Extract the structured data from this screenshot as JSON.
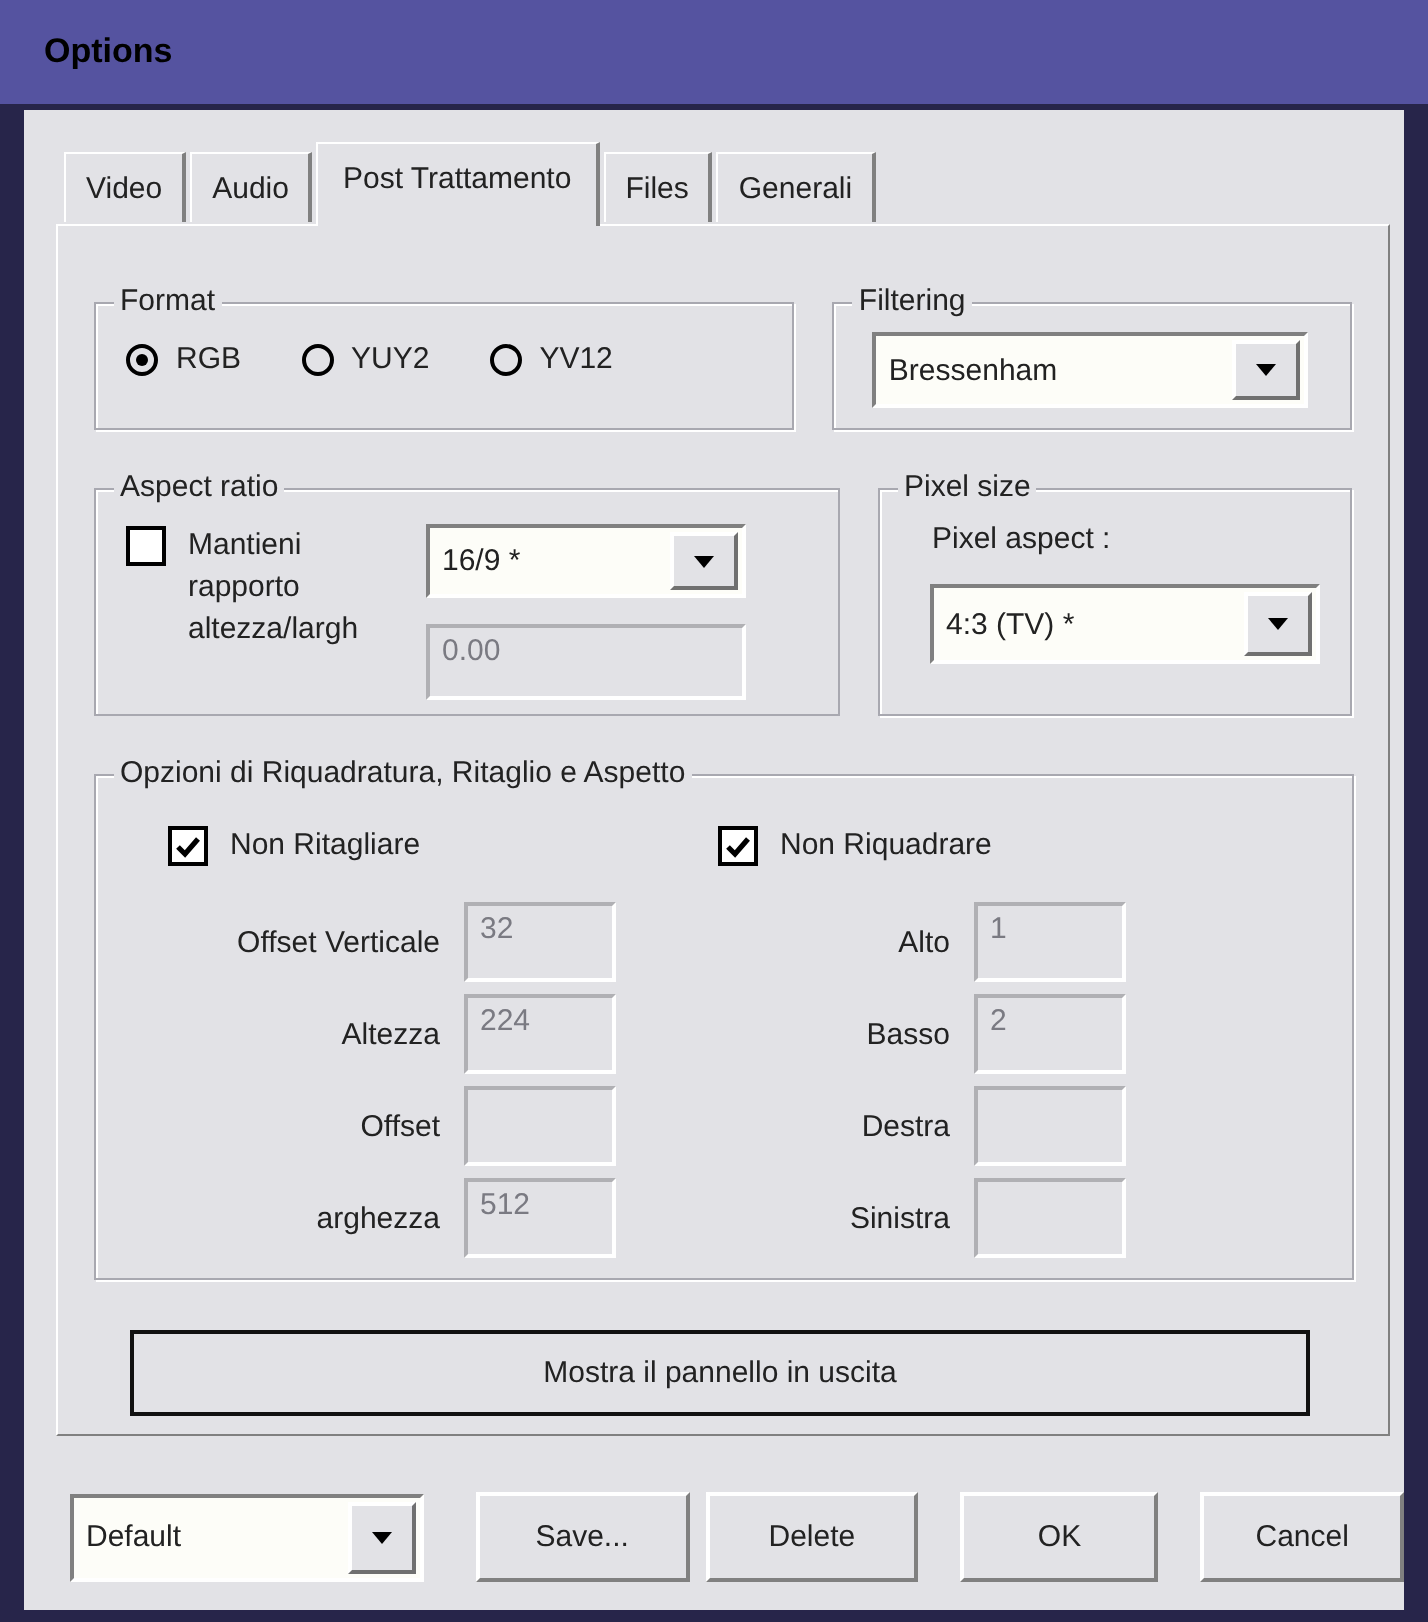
{
  "window": {
    "title": "Options"
  },
  "tabs": [
    {
      "label": "Video",
      "selected": false
    },
    {
      "label": "Audio",
      "selected": false
    },
    {
      "label": "Post Trattamento",
      "selected": true
    },
    {
      "label": "Files",
      "selected": false
    },
    {
      "label": "Generali",
      "selected": false
    }
  ],
  "format": {
    "label": "Format",
    "options": [
      {
        "label": "RGB",
        "selected": true
      },
      {
        "label": "YUY2",
        "selected": false
      },
      {
        "label": "YV12",
        "selected": false
      }
    ]
  },
  "filtering": {
    "label": "Filtering",
    "value": "Bressenham"
  },
  "aspect_ratio": {
    "label": "Aspect ratio",
    "keep_ratio": {
      "label": "Mantieni rapporto altezza/largh",
      "checked": false
    },
    "ratio": {
      "value": "16/9 *"
    },
    "custom": {
      "value": "0.00",
      "disabled": true
    }
  },
  "pixel_size": {
    "label": "Pixel size",
    "field_label": "Pixel aspect :",
    "value": "4:3 (TV) *"
  },
  "crop": {
    "label": "Opzioni di Riquadratura, Ritaglio e Aspetto",
    "checks": [
      {
        "label": "Non Ritagliare",
        "checked": true
      },
      {
        "label": "Non Riquadrare",
        "checked": true
      }
    ],
    "fields": [
      {
        "label": "Offset Verticale",
        "value": "32",
        "disabled": true
      },
      {
        "label": "Alto",
        "value": "1",
        "disabled": true
      },
      {
        "label": "Altezza",
        "value": "224",
        "disabled": true
      },
      {
        "label": "Basso",
        "value": "2",
        "disabled": true
      },
      {
        "label": "Offset",
        "disabled": true
      },
      {
        "label": "Destra",
        "disabled": true
      },
      {
        "label": "arghezza",
        "value": "512",
        "disabled": true
      },
      {
        "label": "Sinistra",
        "disabled": true
      }
    ]
  },
  "output_button": "Mostra il pannello in uscita",
  "profile": {
    "value": "Default"
  },
  "buttons": [
    "Save...",
    "Delete",
    "OK",
    "Cancel"
  ]
}
